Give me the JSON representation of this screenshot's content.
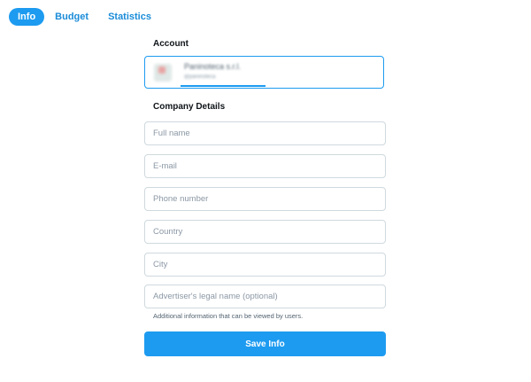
{
  "tabs": [
    {
      "label": "Info",
      "active": true
    },
    {
      "label": "Budget",
      "active": false
    },
    {
      "label": "Statistics",
      "active": false
    }
  ],
  "account": {
    "section_title": "Account",
    "name": "Paninoteca s.r.l.",
    "handle": "@paninoteca"
  },
  "company": {
    "section_title": "Company Details",
    "full_name": {
      "placeholder": "Full name",
      "value": ""
    },
    "email": {
      "placeholder": "E-mail",
      "value": ""
    },
    "phone": {
      "placeholder": "Phone number",
      "value": ""
    },
    "country": {
      "placeholder": "Country",
      "value": ""
    },
    "city": {
      "placeholder": "City",
      "value": ""
    },
    "legal_name": {
      "placeholder": "Advertiser's legal name (optional)",
      "value": ""
    },
    "helper_text": "Additional information that can be viewed by users."
  },
  "save_button": {
    "label": "Save Info"
  },
  "colors": {
    "accent": "#1d9bf0",
    "border": "#cfd9de",
    "placeholder": "#8b98a5",
    "title": "#0f1419"
  }
}
